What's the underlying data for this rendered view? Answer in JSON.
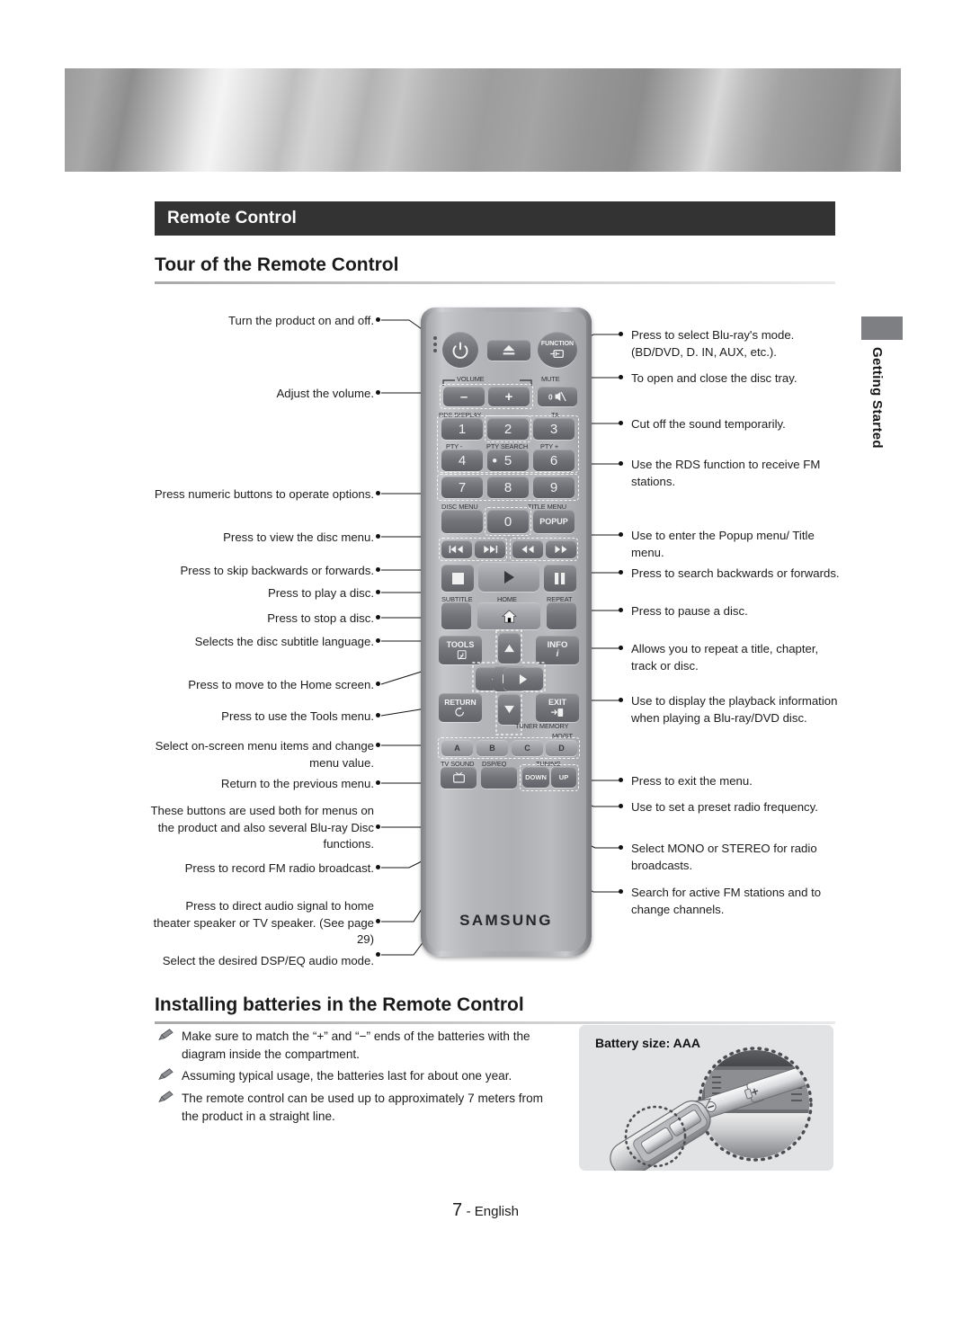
{
  "page": {
    "section_title": "Remote Control",
    "heading_tour": "Tour of the Remote Control",
    "heading_batteries": "Installing batteries in the Remote Control",
    "side_tab": "Getting Started",
    "footer_page": "7",
    "footer_lang": "- English",
    "accent_dark": "#333333",
    "banner_color": "#a8a8a8"
  },
  "callouts_left": [
    {
      "id": "power",
      "text": "Turn the product on and off."
    },
    {
      "id": "volume",
      "text": "Adjust the volume."
    },
    {
      "id": "numeric",
      "text": "Press numeric buttons to operate options."
    },
    {
      "id": "disc-menu",
      "text": "Press to view the disc menu."
    },
    {
      "id": "skip",
      "text": "Press to skip backwards or forwards."
    },
    {
      "id": "play",
      "text": "Press to play a disc."
    },
    {
      "id": "stop",
      "text": "Press to stop a disc."
    },
    {
      "id": "subtitle",
      "text": "Selects the disc subtitle language."
    },
    {
      "id": "home",
      "text": "Press to move to the Home screen."
    },
    {
      "id": "tools",
      "text": "Press to use the Tools menu."
    },
    {
      "id": "dpad",
      "text": "Select on-screen menu items and change menu value."
    },
    {
      "id": "return",
      "text": "Return to the previous menu."
    },
    {
      "id": "color-keys",
      "text": "These buttons are used both for menus on the product and also several Blu-ray Disc functions."
    },
    {
      "id": "record-fm",
      "text": "Press to record FM radio broadcast."
    },
    {
      "id": "tv-sound",
      "text": "Press to direct audio signal to home theater speaker or TV speaker. (See page 29)"
    },
    {
      "id": "dsp-eq",
      "text": "Select the desired DSP/EQ audio mode."
    }
  ],
  "callouts_right": [
    {
      "id": "function",
      "text": "Press to select Blu-ray's mode. (BD/DVD, D. IN, AUX, etc.)."
    },
    {
      "id": "eject",
      "text": "To open and close the disc tray."
    },
    {
      "id": "mute",
      "text": "Cut off the sound temporarily."
    },
    {
      "id": "rds",
      "text": "Use the RDS function to receive FM stations."
    },
    {
      "id": "popup",
      "text": "Use to enter the Popup menu/ Title menu."
    },
    {
      "id": "search",
      "text": "Press to search backwards or forwards."
    },
    {
      "id": "pause",
      "text": "Press to pause a disc."
    },
    {
      "id": "repeat",
      "text": "Allows you to repeat a title, chapter, track or disc."
    },
    {
      "id": "info",
      "text": "Use to display the playback information when playing a Blu-ray/DVD disc."
    },
    {
      "id": "exit",
      "text": "Press to exit the menu."
    },
    {
      "id": "tuner-memory",
      "text": "Use to set a preset radio frequency."
    },
    {
      "id": "mo-st",
      "text": "Select MONO or STEREO for radio broadcasts."
    },
    {
      "id": "tuning",
      "text": "Search for active FM stations and to change channels."
    }
  ],
  "remote": {
    "brand": "SAMSUNG",
    "buttons": {
      "power": "⏻",
      "eject": "▲",
      "function": "FUNCTION",
      "vol_down": "–",
      "vol_up": "+",
      "mute": "0",
      "n1": "1",
      "n2": "2",
      "n3": "3",
      "n4": "4",
      "n5": "5",
      "n6": "6",
      "n7": "7",
      "n8": "8",
      "n9": "9",
      "n0": "0",
      "popup": "POPUP",
      "skip_back": "◄◄|",
      "skip_fwd": "|►►",
      "search_back": "◄◄",
      "search_fwd": "►►",
      "stop": "■",
      "play": "►",
      "pause": "❚❚",
      "tools": "TOOLS",
      "info": "INFO",
      "up": "▲",
      "down": "▼",
      "left": "◄",
      "right": "►",
      "enter": "⏎",
      "return": "RETURN",
      "exit": "EXIT",
      "a": "A",
      "b": "B",
      "c": "C",
      "d": "D",
      "tuning_down": "DOWN",
      "tuning_up": "UP"
    },
    "labels": {
      "volume": "VOLUME",
      "mute": "MUTE",
      "rds_display": "RDS DISPLAY",
      "ta": "TA",
      "pty_minus": "PTY -",
      "pty_search": "PTY SEARCH",
      "pty_plus": "PTY +",
      "disc_menu": "DISC MENU",
      "title_menu": "TITLE MENU",
      "subtitle": "SUBTITLE",
      "home": "HOME",
      "repeat": "REPEAT",
      "tuner_memory": "TUNER MEMORY",
      "mo_st": "MO/ST",
      "tv_sound": "TV SOUND",
      "dsp_eq": "DSP/EQ",
      "tuning": "TUNING"
    }
  },
  "notes": [
    "Make sure to match the “+” and “−” ends of the batteries with the diagram inside the compartment.",
    "Assuming typical usage, the batteries last for about one year.",
    "The remote control can be used up to approximately 7 meters from the product in a straight line."
  ],
  "battery_box": {
    "title": "Battery size: AAA"
  }
}
